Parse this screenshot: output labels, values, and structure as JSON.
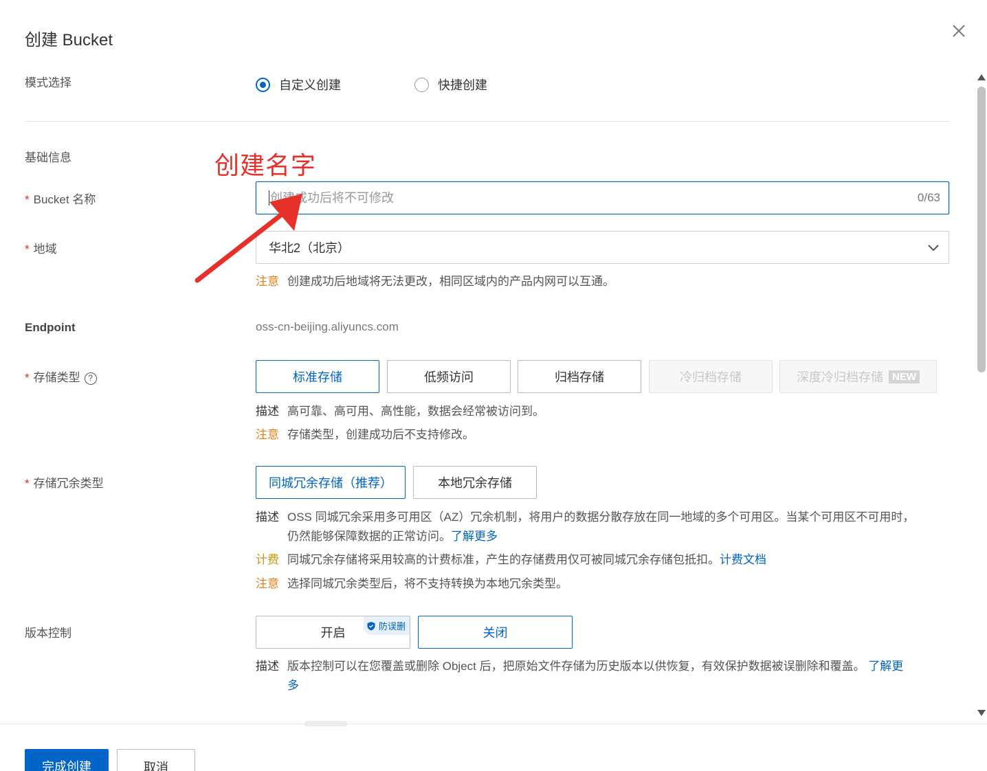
{
  "dialog": {
    "title": "创建 Bucket"
  },
  "mode": {
    "label": "模式选择",
    "options": [
      {
        "label": "自定义创建",
        "checked": true
      },
      {
        "label": "快捷创建",
        "checked": false
      }
    ]
  },
  "basic_info": {
    "label": "基础信息"
  },
  "annotation": {
    "text": "创建名字",
    "color": "#e8302a"
  },
  "bucket_name": {
    "label": "Bucket 名称",
    "required_mark": "*",
    "placeholder": "创建成功后将不可修改",
    "value": "",
    "counter": "0/63"
  },
  "region": {
    "label": "地域",
    "required_mark": "*",
    "value": "华北2（北京）",
    "note_tag": "注意",
    "note": "创建成功后地域将无法更改，相同区域内的产品内网可以互通。"
  },
  "endpoint": {
    "label": "Endpoint",
    "value": "oss-cn-beijing.aliyuncs.com"
  },
  "storage_class": {
    "label": "存储类型",
    "required_mark": "*",
    "help_icon": "?",
    "options": [
      {
        "label": "标准存储",
        "state": "selected"
      },
      {
        "label": "低频访问",
        "state": "normal"
      },
      {
        "label": "归档存储",
        "state": "normal"
      },
      {
        "label": "冷归档存储",
        "state": "disabled"
      },
      {
        "label": "深度冷归档存储",
        "state": "disabled",
        "badge": "NEW"
      }
    ],
    "desc_tag": "描述",
    "desc": "高可靠、高可用、高性能，数据会经常被访问到。",
    "note_tag": "注意",
    "note": "存储类型，创建成功后不支持修改。"
  },
  "redundancy": {
    "label": "存储冗余类型",
    "required_mark": "*",
    "options": [
      {
        "label": "同城冗余存储（推荐）",
        "state": "selected"
      },
      {
        "label": "本地冗余存储",
        "state": "normal"
      }
    ],
    "desc_tag": "描述",
    "desc_line1": "OSS 同城冗余采用多可用区（AZ）冗余机制，将用户的数据分散存放在同一地域的多个可用区。当某个可用区不可用时，",
    "desc_line2": "仍然能够保障数据的正常访问。",
    "desc_link": "了解更多",
    "fee_tag": "计费",
    "fee": "同城冗余存储将采用较高的计费标准，产生的存储费用仅可被同城冗余存储包抵扣。",
    "fee_link": "计费文档",
    "note_tag": "注意",
    "note": "选择同城冗余类型后，将不支持转换为本地冗余类型。"
  },
  "versioning": {
    "label": "版本控制",
    "options": [
      {
        "label": "开启",
        "state": "normal",
        "badge": "防误删"
      },
      {
        "label": "关闭",
        "state": "selected"
      }
    ],
    "desc_tag": "描述",
    "desc": "版本控制可以在您覆盖或删除 Object 后，把原始文件存储为历史版本以供恢复，有效保护数据被误删除和覆盖。",
    "desc_link_part1": "了解更",
    "desc_link_part2": "多"
  },
  "footer": {
    "confirm": "完成创建",
    "cancel": "取消"
  },
  "colors": {
    "primary": "#0064c8",
    "warn": "#e8801a",
    "fee": "#c8960a",
    "required": "#d93026"
  }
}
